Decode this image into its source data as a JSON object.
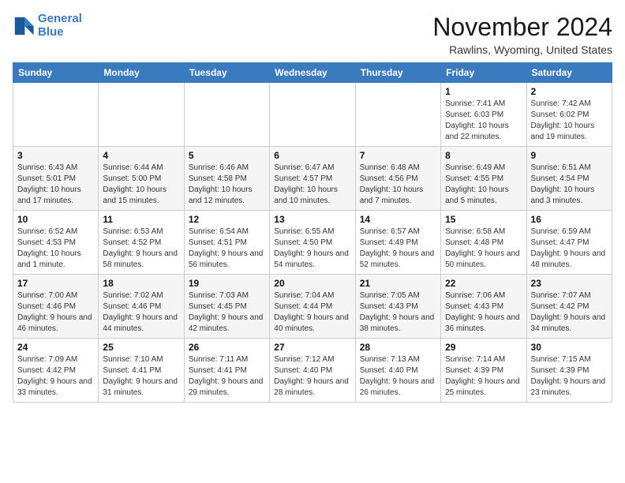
{
  "logo": {
    "line1": "General",
    "line2": "Blue"
  },
  "title": "November 2024",
  "location": "Rawlins, Wyoming, United States",
  "weekdays": [
    "Sunday",
    "Monday",
    "Tuesday",
    "Wednesday",
    "Thursday",
    "Friday",
    "Saturday"
  ],
  "weeks": [
    [
      {
        "day": "",
        "info": ""
      },
      {
        "day": "",
        "info": ""
      },
      {
        "day": "",
        "info": ""
      },
      {
        "day": "",
        "info": ""
      },
      {
        "day": "",
        "info": ""
      },
      {
        "day": "1",
        "info": "Sunrise: 7:41 AM\nSunset: 6:03 PM\nDaylight: 10 hours and 22 minutes."
      },
      {
        "day": "2",
        "info": "Sunrise: 7:42 AM\nSunset: 6:02 PM\nDaylight: 10 hours and 19 minutes."
      }
    ],
    [
      {
        "day": "3",
        "info": "Sunrise: 6:43 AM\nSunset: 5:01 PM\nDaylight: 10 hours and 17 minutes."
      },
      {
        "day": "4",
        "info": "Sunrise: 6:44 AM\nSunset: 5:00 PM\nDaylight: 10 hours and 15 minutes."
      },
      {
        "day": "5",
        "info": "Sunrise: 6:46 AM\nSunset: 4:58 PM\nDaylight: 10 hours and 12 minutes."
      },
      {
        "day": "6",
        "info": "Sunrise: 6:47 AM\nSunset: 4:57 PM\nDaylight: 10 hours and 10 minutes."
      },
      {
        "day": "7",
        "info": "Sunrise: 6:48 AM\nSunset: 4:56 PM\nDaylight: 10 hours and 7 minutes."
      },
      {
        "day": "8",
        "info": "Sunrise: 6:49 AM\nSunset: 4:55 PM\nDaylight: 10 hours and 5 minutes."
      },
      {
        "day": "9",
        "info": "Sunrise: 6:51 AM\nSunset: 4:54 PM\nDaylight: 10 hours and 3 minutes."
      }
    ],
    [
      {
        "day": "10",
        "info": "Sunrise: 6:52 AM\nSunset: 4:53 PM\nDaylight: 10 hours and 1 minute."
      },
      {
        "day": "11",
        "info": "Sunrise: 6:53 AM\nSunset: 4:52 PM\nDaylight: 9 hours and 58 minutes."
      },
      {
        "day": "12",
        "info": "Sunrise: 6:54 AM\nSunset: 4:51 PM\nDaylight: 9 hours and 56 minutes."
      },
      {
        "day": "13",
        "info": "Sunrise: 6:55 AM\nSunset: 4:50 PM\nDaylight: 9 hours and 54 minutes."
      },
      {
        "day": "14",
        "info": "Sunrise: 6:57 AM\nSunset: 4:49 PM\nDaylight: 9 hours and 52 minutes."
      },
      {
        "day": "15",
        "info": "Sunrise: 6:58 AM\nSunset: 4:48 PM\nDaylight: 9 hours and 50 minutes."
      },
      {
        "day": "16",
        "info": "Sunrise: 6:59 AM\nSunset: 4:47 PM\nDaylight: 9 hours and 48 minutes."
      }
    ],
    [
      {
        "day": "17",
        "info": "Sunrise: 7:00 AM\nSunset: 4:46 PM\nDaylight: 9 hours and 46 minutes."
      },
      {
        "day": "18",
        "info": "Sunrise: 7:02 AM\nSunset: 4:46 PM\nDaylight: 9 hours and 44 minutes."
      },
      {
        "day": "19",
        "info": "Sunrise: 7:03 AM\nSunset: 4:45 PM\nDaylight: 9 hours and 42 minutes."
      },
      {
        "day": "20",
        "info": "Sunrise: 7:04 AM\nSunset: 4:44 PM\nDaylight: 9 hours and 40 minutes."
      },
      {
        "day": "21",
        "info": "Sunrise: 7:05 AM\nSunset: 4:43 PM\nDaylight: 9 hours and 38 minutes."
      },
      {
        "day": "22",
        "info": "Sunrise: 7:06 AM\nSunset: 4:43 PM\nDaylight: 9 hours and 36 minutes."
      },
      {
        "day": "23",
        "info": "Sunrise: 7:07 AM\nSunset: 4:42 PM\nDaylight: 9 hours and 34 minutes."
      }
    ],
    [
      {
        "day": "24",
        "info": "Sunrise: 7:09 AM\nSunset: 4:42 PM\nDaylight: 9 hours and 33 minutes."
      },
      {
        "day": "25",
        "info": "Sunrise: 7:10 AM\nSunset: 4:41 PM\nDaylight: 9 hours and 31 minutes."
      },
      {
        "day": "26",
        "info": "Sunrise: 7:11 AM\nSunset: 4:41 PM\nDaylight: 9 hours and 29 minutes."
      },
      {
        "day": "27",
        "info": "Sunrise: 7:12 AM\nSunset: 4:40 PM\nDaylight: 9 hours and 28 minutes."
      },
      {
        "day": "28",
        "info": "Sunrise: 7:13 AM\nSunset: 4:40 PM\nDaylight: 9 hours and 26 minutes."
      },
      {
        "day": "29",
        "info": "Sunrise: 7:14 AM\nSunset: 4:39 PM\nDaylight: 9 hours and 25 minutes."
      },
      {
        "day": "30",
        "info": "Sunrise: 7:15 AM\nSunset: 4:39 PM\nDaylight: 9 hours and 23 minutes."
      }
    ]
  ]
}
